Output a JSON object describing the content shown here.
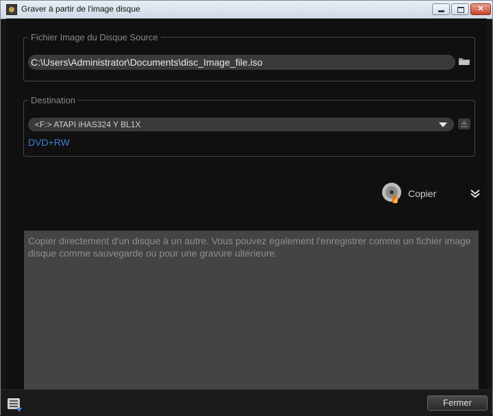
{
  "window": {
    "title": "Graver à partir de l'image disque"
  },
  "source": {
    "legend": "Fichier Image du Disque Source",
    "path": "C:\\Users\\Administrator\\Documents\\disc_Image_file.iso"
  },
  "destination": {
    "legend": "Destination",
    "drive": "<F:>  ATAPI iHAS324   Y BL1X",
    "disc_type": "DVD+RW"
  },
  "action": {
    "copy_label": "Copier"
  },
  "description": "Copier directement d'un disque à un autre. Vous pouvez également l'enregistrer comme un fichier image disque comme sauvegarde ou pour une gravure ultérieure.",
  "footer": {
    "close_label": "Fermer"
  },
  "icons": {
    "app": "burn-app-icon",
    "folder": "folder-icon",
    "eject": "eject-icon",
    "copy": "disc-burn-icon",
    "expand": "double-chevron-down-icon",
    "settings": "settings-list-icon"
  },
  "colors": {
    "disc_type": "#3f7fd4",
    "background": "#101010",
    "description_bg": "#444444"
  }
}
